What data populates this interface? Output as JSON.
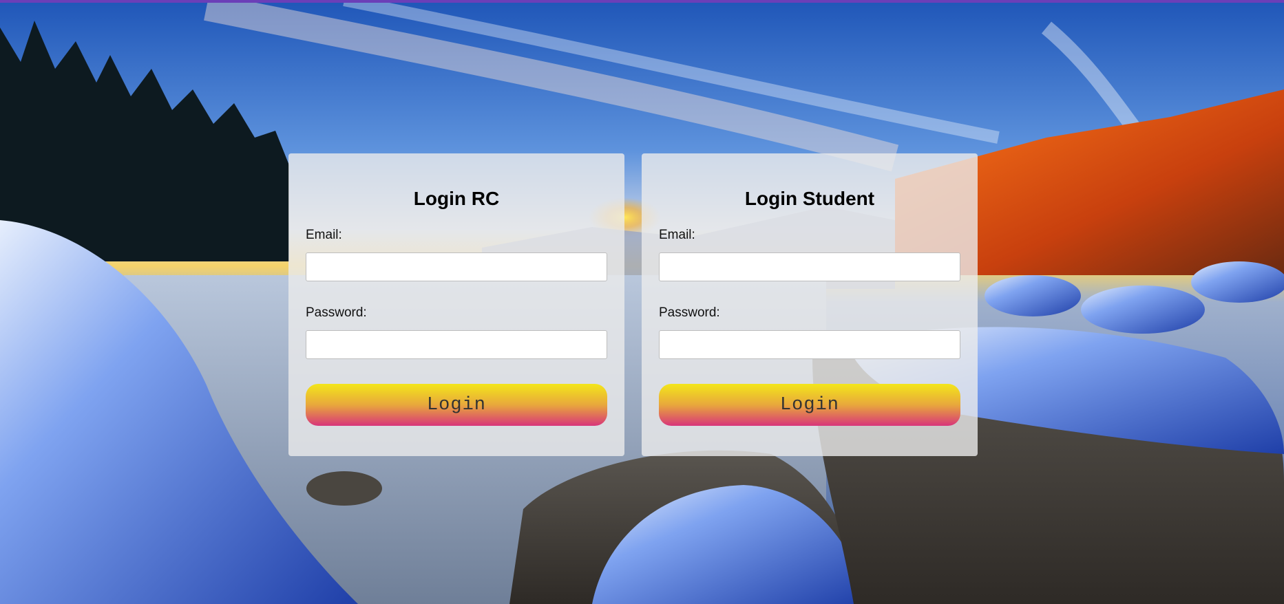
{
  "colors": {
    "top_bar": "#6b3fb8",
    "panel_bg": "rgba(235,235,235,0.80)",
    "button_gradient_top": "#f3e61a",
    "button_gradient_bottom": "#d8357a"
  },
  "login_rc": {
    "title": "Login RC",
    "email_label": "Email:",
    "email_value": "",
    "password_label": "Password:",
    "password_value": "",
    "button_label": "Login"
  },
  "login_student": {
    "title": "Login Student",
    "email_label": "Email:",
    "email_value": "",
    "password_label": "Password:",
    "password_value": "",
    "button_label": "Login"
  }
}
